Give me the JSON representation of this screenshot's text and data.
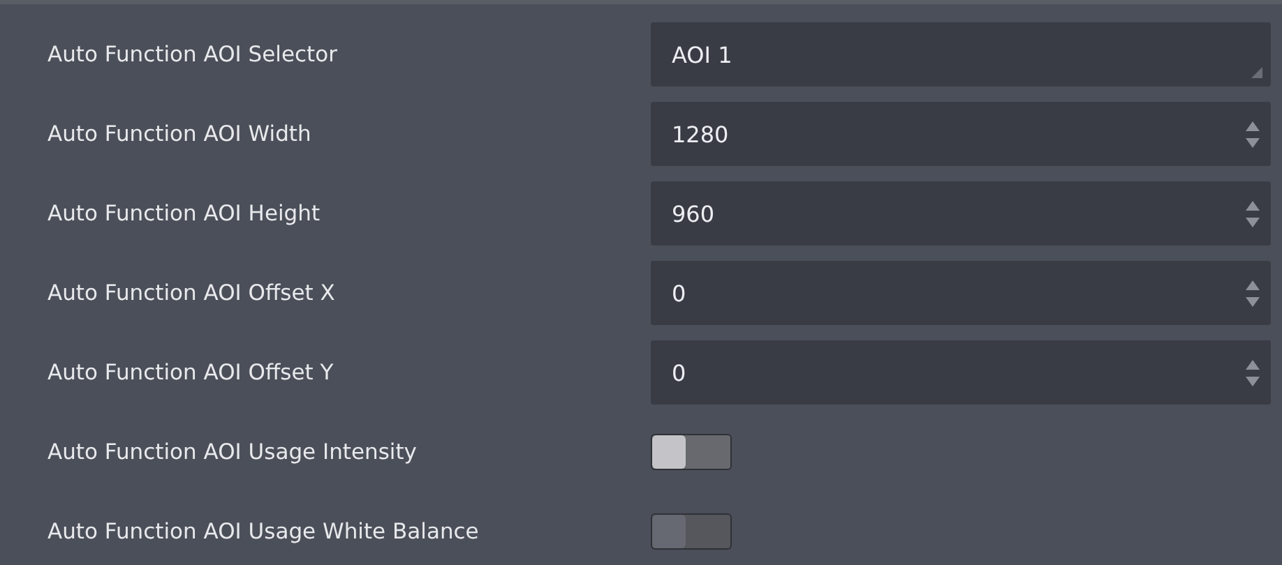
{
  "rows": [
    {
      "label": "Auto Function AOI Selector",
      "kind": "dropdown",
      "value": "AOI 1"
    },
    {
      "label": "Auto Function AOI Width",
      "kind": "spinner",
      "value": "1280"
    },
    {
      "label": "Auto Function AOI Height",
      "kind": "spinner",
      "value": "960"
    },
    {
      "label": "Auto Function AOI Offset X",
      "kind": "spinner",
      "value": "0"
    },
    {
      "label": "Auto Function AOI Offset Y",
      "kind": "spinner",
      "value": "0"
    },
    {
      "label": "Auto Function AOI Usage Intensity",
      "kind": "toggle",
      "on": false,
      "disabled": false
    },
    {
      "label": "Auto Function AOI Usage White Balance",
      "kind": "toggle",
      "on": false,
      "disabled": true
    }
  ]
}
